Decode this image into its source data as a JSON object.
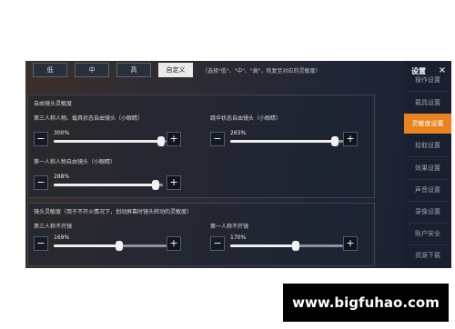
{
  "presets": {
    "tabs": [
      "低",
      "中",
      "高",
      "自定义"
    ],
    "active_tab": "自定义",
    "hint": "（选择\"低\"、\"中\"、\"高\"，恢复至对应的灵敏度）"
  },
  "free_look": {
    "title": "自由镜头灵敏度",
    "sliders": [
      {
        "label": "第三人称人物、载具状态自由镜头（小眼睛）",
        "value": "300%",
        "level": 0.95
      },
      {
        "label": "跳伞状态自由镜头（小眼睛）",
        "value": "263%",
        "level": 0.9
      },
      {
        "label": "第一人称人物自由镜头（小眼睛）",
        "value": "288%",
        "level": 0.93
      }
    ]
  },
  "camera": {
    "title": "镜头灵敏度（用于不开火情况下，划动屏幕时镜头转动的灵敏度）",
    "sliders": [
      {
        "label": "第三人称不开镜",
        "value": "169%",
        "level": 0.58
      },
      {
        "label": "第一人称不开镜",
        "value": "170%",
        "level": 0.58
      }
    ]
  },
  "buttons": {
    "minus": "−",
    "plus": "+"
  },
  "sidebar": {
    "title": "设置",
    "close": "×",
    "items": [
      "操作设置",
      "载具设置",
      "灵敏度设置",
      "拾取设置",
      "效果设置",
      "声音设置",
      "录像设置",
      "账户安全",
      "资源下载"
    ],
    "active_item": "灵敏度设置"
  },
  "watermark": "www.bigfuhao.com",
  "colors": {
    "accent": "#e98220",
    "panel": "#1a2030",
    "slider_fill": "#f0f0f0"
  }
}
